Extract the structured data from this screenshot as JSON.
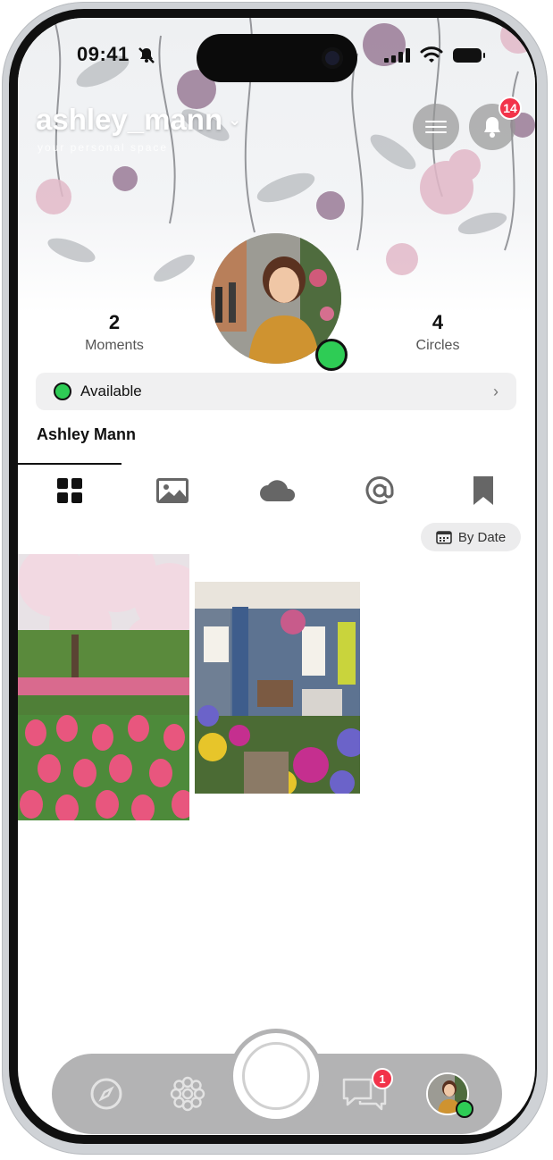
{
  "status_bar": {
    "time": "09:41"
  },
  "header": {
    "username": "ashley_mann",
    "subtitle": "your personal space",
    "notification_count": "14"
  },
  "profile": {
    "moments_count": "2",
    "moments_label": "Moments",
    "circles_count": "4",
    "circles_label": "Circles",
    "availability": "Available",
    "full_name": "Ashley Mann"
  },
  "tabs": [
    {
      "icon": "grid-icon",
      "active": true
    },
    {
      "icon": "image-icon",
      "active": false
    },
    {
      "icon": "cloud-icon",
      "active": false
    },
    {
      "icon": "at-icon",
      "active": false
    },
    {
      "icon": "bookmark-icon",
      "active": false
    }
  ],
  "sort": {
    "label": "By Date"
  },
  "moments": [
    {
      "image": "pink-tulips-cherry-blossom"
    },
    {
      "image": "porch-with-flowers"
    }
  ],
  "dock": {
    "chat_badge": "1",
    "items": [
      "compass-icon",
      "flower-icon",
      "capture-button",
      "chat-icon",
      "profile-avatar"
    ]
  },
  "colors": {
    "online": "#2ecc55",
    "badge": "#f2334a",
    "dock": "#b3b3b4"
  }
}
